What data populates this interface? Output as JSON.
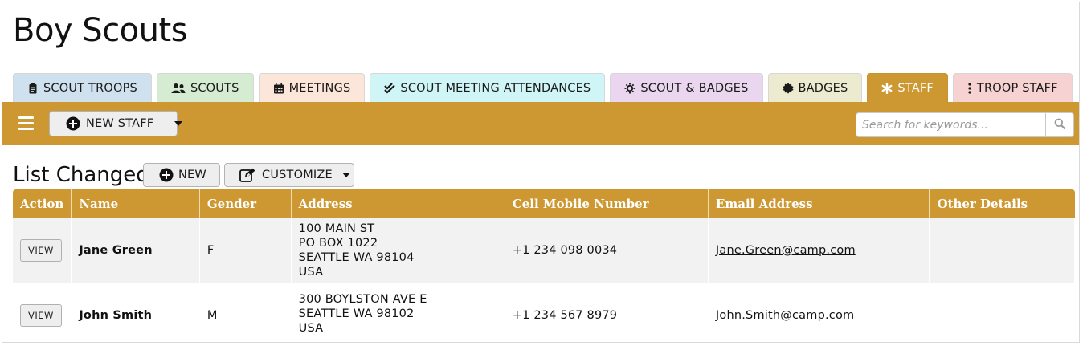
{
  "app": {
    "title": "Boy Scouts"
  },
  "tabs": [
    {
      "label": "SCOUT TROOPS",
      "icon": "clipboard-icon",
      "bg": "#cfe0ee"
    },
    {
      "label": "SCOUTS",
      "icon": "users-icon",
      "bg": "#d6ecd2"
    },
    {
      "label": "MEETINGS",
      "icon": "calendar-icon",
      "bg": "#fce6d9"
    },
    {
      "label": "SCOUT MEETING ATTENDANCES",
      "icon": "double-check-icon",
      "bg": "#cff5f7"
    },
    {
      "label": "SCOUT & BADGES",
      "icon": "sun-icon",
      "bg": "#ead6ee"
    },
    {
      "label": "BADGES",
      "icon": "certificate-icon",
      "bg": "#ecebd0"
    },
    {
      "label": "STAFF",
      "icon": "asterisk-icon",
      "bg": "#cd9832",
      "active": true
    },
    {
      "label": "TROOP STAFF",
      "icon": "vertical-ellipsis-icon",
      "bg": "#f7d2d2"
    }
  ],
  "toolbar": {
    "menu_icon": "hamburger-icon",
    "new_staff_label": "NEW STAFF",
    "search_placeholder": "Search for keywords...",
    "search_icon": "search-icon",
    "color": "#cd9832"
  },
  "list": {
    "title": "List Changed",
    "new_label": "NEW",
    "customize_label": "CUSTOMIZE",
    "columns": [
      "Action",
      "Name",
      "Gender",
      "Address",
      "Cell Mobile Number",
      "Email Address",
      "Other Details"
    ],
    "rows": [
      {
        "action": "VIEW",
        "name": "Jane Green",
        "gender": "F",
        "address": [
          "100 MAIN ST",
          "PO BOX 1022",
          "SEATTLE WA 98104",
          "USA"
        ],
        "phone": "+1 234 098 0034",
        "email": "Jane.Green@camp.com",
        "other": ""
      },
      {
        "action": "VIEW",
        "name": "John Smith",
        "gender": "M",
        "address": [
          "300 BOYLSTON AVE E",
          "SEATTLE WA 98102",
          "USA"
        ],
        "phone": "+1 234 567 8979",
        "email": "John.Smith@camp.com",
        "other": ""
      }
    ]
  }
}
